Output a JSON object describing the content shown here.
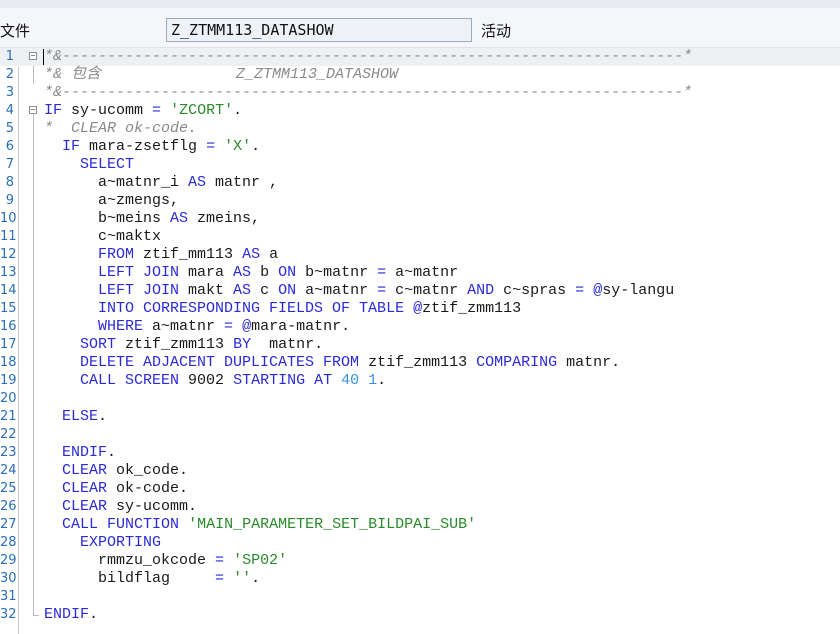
{
  "toolbar": {
    "menu_file": "文件",
    "object_name": "Z_ZTMM113_DATASHOW",
    "menu_activate": "活动"
  },
  "colors": {
    "keyword": "#2a2ad6",
    "string": "#2a8a2a",
    "number": "#3a8fe0",
    "comment": "#8a8a8a",
    "line_number": "#2a6fb8"
  },
  "editor": {
    "lines": [
      {
        "n": "1",
        "tokens": [
          {
            "t": "*&---------------------------------------------------------------------*",
            "c": "cmt"
          }
        ]
      },
      {
        "n": "2",
        "tokens": [
          {
            "t": "*& 包含               Z_ZTMM113_DATASHOW",
            "c": "cmt"
          }
        ]
      },
      {
        "n": "3",
        "tokens": [
          {
            "t": "*&---------------------------------------------------------------------*",
            "c": "cmt"
          }
        ]
      },
      {
        "n": "4",
        "tokens": [
          {
            "t": "IF",
            "c": "kw"
          },
          {
            "t": " sy-ucomm ",
            "c": "txt"
          },
          {
            "t": "=",
            "c": "kw"
          },
          {
            "t": " ",
            "c": "txt"
          },
          {
            "t": "'ZCORT'",
            "c": "str"
          },
          {
            "t": ".",
            "c": "txt"
          }
        ]
      },
      {
        "n": "5",
        "tokens": [
          {
            "t": "*  CLEAR ok-code.",
            "c": "cmt"
          }
        ]
      },
      {
        "n": "6",
        "tokens": [
          {
            "t": "  ",
            "c": "txt"
          },
          {
            "t": "IF",
            "c": "kw"
          },
          {
            "t": " mara-zsetflg ",
            "c": "txt"
          },
          {
            "t": "=",
            "c": "kw"
          },
          {
            "t": " ",
            "c": "txt"
          },
          {
            "t": "'X'",
            "c": "str"
          },
          {
            "t": ".",
            "c": "txt"
          }
        ]
      },
      {
        "n": "7",
        "tokens": [
          {
            "t": "    ",
            "c": "txt"
          },
          {
            "t": "SELECT",
            "c": "kw"
          }
        ]
      },
      {
        "n": "8",
        "tokens": [
          {
            "t": "      a~matnr_i ",
            "c": "txt"
          },
          {
            "t": "AS",
            "c": "kw"
          },
          {
            "t": " matnr ,",
            "c": "txt"
          }
        ]
      },
      {
        "n": "9",
        "tokens": [
          {
            "t": "      a~zmengs,",
            "c": "txt"
          }
        ]
      },
      {
        "n": "10",
        "tokens": [
          {
            "t": "      b~meins ",
            "c": "txt"
          },
          {
            "t": "AS",
            "c": "kw"
          },
          {
            "t": " zmeins,",
            "c": "txt"
          }
        ]
      },
      {
        "n": "11",
        "tokens": [
          {
            "t": "      c~maktx",
            "c": "txt"
          }
        ]
      },
      {
        "n": "12",
        "tokens": [
          {
            "t": "      ",
            "c": "txt"
          },
          {
            "t": "FROM",
            "c": "kw"
          },
          {
            "t": " ztif_mm113 ",
            "c": "txt"
          },
          {
            "t": "AS",
            "c": "kw"
          },
          {
            "t": " a",
            "c": "txt"
          }
        ]
      },
      {
        "n": "13",
        "tokens": [
          {
            "t": "      ",
            "c": "txt"
          },
          {
            "t": "LEFT JOIN",
            "c": "kw"
          },
          {
            "t": " mara ",
            "c": "txt"
          },
          {
            "t": "AS",
            "c": "kw"
          },
          {
            "t": " b ",
            "c": "txt"
          },
          {
            "t": "ON",
            "c": "kw"
          },
          {
            "t": " b~matnr ",
            "c": "txt"
          },
          {
            "t": "=",
            "c": "kw"
          },
          {
            "t": " a~matnr",
            "c": "txt"
          }
        ]
      },
      {
        "n": "14",
        "tokens": [
          {
            "t": "      ",
            "c": "txt"
          },
          {
            "t": "LEFT JOIN",
            "c": "kw"
          },
          {
            "t": " makt ",
            "c": "txt"
          },
          {
            "t": "AS",
            "c": "kw"
          },
          {
            "t": " c ",
            "c": "txt"
          },
          {
            "t": "ON",
            "c": "kw"
          },
          {
            "t": " a~matnr ",
            "c": "txt"
          },
          {
            "t": "=",
            "c": "kw"
          },
          {
            "t": " c~matnr ",
            "c": "txt"
          },
          {
            "t": "AND",
            "c": "kw"
          },
          {
            "t": " c~spras ",
            "c": "txt"
          },
          {
            "t": "=",
            "c": "kw"
          },
          {
            "t": " ",
            "c": "txt"
          },
          {
            "t": "@",
            "c": "kw"
          },
          {
            "t": "sy-langu",
            "c": "txt"
          }
        ]
      },
      {
        "n": "15",
        "tokens": [
          {
            "t": "      ",
            "c": "txt"
          },
          {
            "t": "INTO CORRESPONDING FIELDS OF TABLE",
            "c": "kw"
          },
          {
            "t": " ",
            "c": "txt"
          },
          {
            "t": "@",
            "c": "kw"
          },
          {
            "t": "ztif_zmm113",
            "c": "txt"
          }
        ]
      },
      {
        "n": "16",
        "tokens": [
          {
            "t": "      ",
            "c": "txt"
          },
          {
            "t": "WHERE",
            "c": "kw"
          },
          {
            "t": " a~matnr ",
            "c": "txt"
          },
          {
            "t": "=",
            "c": "kw"
          },
          {
            "t": " ",
            "c": "txt"
          },
          {
            "t": "@",
            "c": "kw"
          },
          {
            "t": "mara-matnr.",
            "c": "txt"
          }
        ]
      },
      {
        "n": "17",
        "tokens": [
          {
            "t": "    ",
            "c": "txt"
          },
          {
            "t": "SORT",
            "c": "kw"
          },
          {
            "t": " ztif_zmm113 ",
            "c": "txt"
          },
          {
            "t": "BY",
            "c": "kw"
          },
          {
            "t": "  matnr.",
            "c": "txt"
          }
        ]
      },
      {
        "n": "18",
        "tokens": [
          {
            "t": "    ",
            "c": "txt"
          },
          {
            "t": "DELETE ADJACENT DUPLICATES FROM",
            "c": "kw"
          },
          {
            "t": " ztif_zmm113 ",
            "c": "txt"
          },
          {
            "t": "COMPARING",
            "c": "kw"
          },
          {
            "t": " matnr.",
            "c": "txt"
          }
        ]
      },
      {
        "n": "19",
        "tokens": [
          {
            "t": "    ",
            "c": "txt"
          },
          {
            "t": "CALL SCREEN",
            "c": "kw"
          },
          {
            "t": " 9002 ",
            "c": "txt"
          },
          {
            "t": "STARTING AT",
            "c": "kw"
          },
          {
            "t": " ",
            "c": "txt"
          },
          {
            "t": "40",
            "c": "num"
          },
          {
            "t": " ",
            "c": "txt"
          },
          {
            "t": "1",
            "c": "num"
          },
          {
            "t": ".",
            "c": "txt"
          }
        ]
      },
      {
        "n": "20",
        "tokens": []
      },
      {
        "n": "21",
        "tokens": [
          {
            "t": "  ",
            "c": "txt"
          },
          {
            "t": "ELSE",
            "c": "kw"
          },
          {
            "t": ".",
            "c": "txt"
          }
        ]
      },
      {
        "n": "22",
        "tokens": []
      },
      {
        "n": "23",
        "tokens": [
          {
            "t": "  ",
            "c": "txt"
          },
          {
            "t": "ENDIF",
            "c": "kw"
          },
          {
            "t": ".",
            "c": "txt"
          }
        ]
      },
      {
        "n": "24",
        "tokens": [
          {
            "t": "  ",
            "c": "txt"
          },
          {
            "t": "CLEAR",
            "c": "kw"
          },
          {
            "t": " ok_code.",
            "c": "txt"
          }
        ]
      },
      {
        "n": "25",
        "tokens": [
          {
            "t": "  ",
            "c": "txt"
          },
          {
            "t": "CLEAR",
            "c": "kw"
          },
          {
            "t": " ok-code.",
            "c": "txt"
          }
        ]
      },
      {
        "n": "26",
        "tokens": [
          {
            "t": "  ",
            "c": "txt"
          },
          {
            "t": "CLEAR",
            "c": "kw"
          },
          {
            "t": " sy-ucomm.",
            "c": "txt"
          }
        ]
      },
      {
        "n": "27",
        "tokens": [
          {
            "t": "  ",
            "c": "txt"
          },
          {
            "t": "CALL FUNCTION",
            "c": "kw"
          },
          {
            "t": " ",
            "c": "txt"
          },
          {
            "t": "'MAIN_PARAMETER_SET_BILDPAI_SUB'",
            "c": "str"
          }
        ]
      },
      {
        "n": "28",
        "tokens": [
          {
            "t": "    ",
            "c": "txt"
          },
          {
            "t": "EXPORTING",
            "c": "kw"
          }
        ]
      },
      {
        "n": "29",
        "tokens": [
          {
            "t": "      rmmzu_okcode ",
            "c": "txt"
          },
          {
            "t": "=",
            "c": "kw"
          },
          {
            "t": " ",
            "c": "txt"
          },
          {
            "t": "'SP02'",
            "c": "str"
          }
        ]
      },
      {
        "n": "30",
        "tokens": [
          {
            "t": "      bildflag     ",
            "c": "txt"
          },
          {
            "t": "=",
            "c": "kw"
          },
          {
            "t": " ",
            "c": "txt"
          },
          {
            "t": "''",
            "c": "str"
          },
          {
            "t": ".",
            "c": "txt"
          }
        ]
      },
      {
        "n": "31",
        "tokens": []
      },
      {
        "n": "32",
        "tokens": [
          {
            "t": "ENDIF",
            "c": "kw"
          },
          {
            "t": ".",
            "c": "txt"
          }
        ]
      }
    ]
  }
}
